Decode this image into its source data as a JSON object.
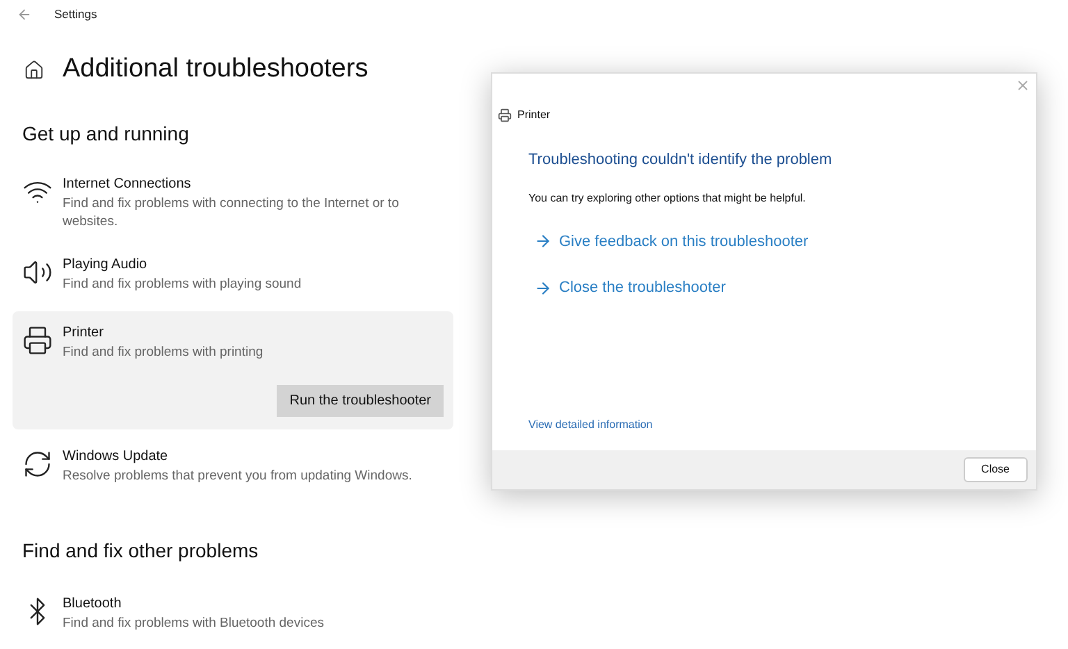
{
  "window": {
    "title": "Settings"
  },
  "page": {
    "title": "Additional troubleshooters"
  },
  "sections": [
    {
      "heading": "Get up and running",
      "items": [
        {
          "kind": "internet",
          "title": "Internet Connections",
          "description": "Find and fix problems with connecting to the Internet or to websites.",
          "selected": false
        },
        {
          "kind": "audio",
          "title": "Playing Audio",
          "description": "Find and fix problems with playing sound",
          "selected": false
        },
        {
          "kind": "printer",
          "title": "Printer",
          "description": "Find and fix problems with printing",
          "selected": true,
          "button": "Run the troubleshooter"
        },
        {
          "kind": "update",
          "title": "Windows Update",
          "description": "Resolve problems that prevent you from updating Windows.",
          "selected": false
        }
      ]
    },
    {
      "heading": "Find and fix other problems",
      "items": [
        {
          "kind": "bluetooth",
          "title": "Bluetooth",
          "description": "Find and fix problems with Bluetooth devices",
          "selected": false
        }
      ]
    }
  ],
  "dialog": {
    "title": "Printer",
    "heading": "Troubleshooting couldn't identify the problem",
    "message": "You can try exploring other options that might be helpful.",
    "links": [
      "Give feedback on this troubleshooter",
      "Close the troubleshooter"
    ],
    "details_link": "View detailed information",
    "button": "Close"
  }
}
